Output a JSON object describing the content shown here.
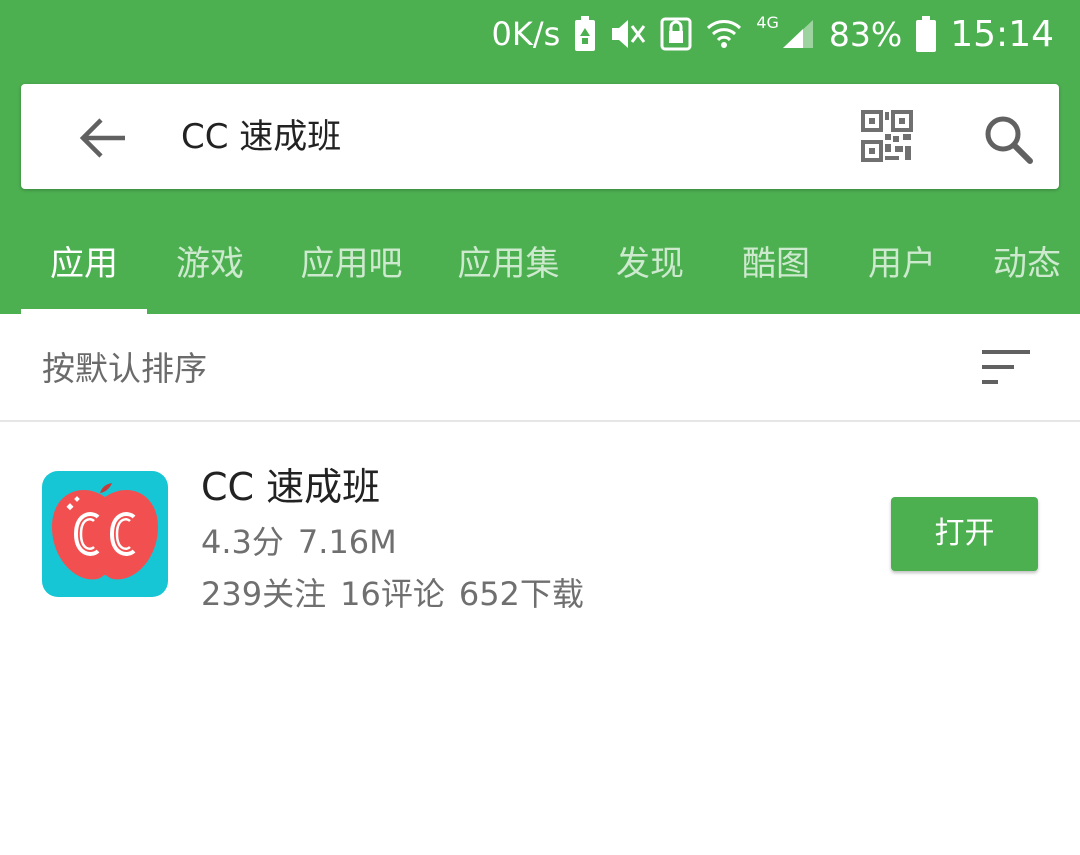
{
  "colors": {
    "primary_green": "#4caf50",
    "app_icon_bg": "#16c6d5",
    "app_icon_fg": "#f25050"
  },
  "status_bar": {
    "net_speed": "0K/s",
    "network_type": "4G",
    "battery_percent": "83%",
    "time": "15:14",
    "icons": [
      "battery-saver-icon",
      "vibrate-mute-icon",
      "nfc-lock-icon",
      "wifi-icon",
      "signal-icon",
      "battery-icon"
    ]
  },
  "search": {
    "query": "CC 速成班",
    "icons": [
      "back-arrow-icon",
      "qr-code-icon",
      "search-icon"
    ]
  },
  "tabs": [
    {
      "label": "应用",
      "active": true
    },
    {
      "label": "游戏"
    },
    {
      "label": "应用吧"
    },
    {
      "label": "应用集"
    },
    {
      "label": "发现"
    },
    {
      "label": "酷图"
    },
    {
      "label": "用户"
    },
    {
      "label": "动态"
    }
  ],
  "sort": {
    "label": "按默认排序",
    "icon": "sort-icon"
  },
  "results": [
    {
      "name": "CC 速成班",
      "rating": "4.3分",
      "size": "7.16M",
      "follows": "239关注",
      "comments": "16评论",
      "downloads": "652下载",
      "button_label": "打开",
      "icon": "cc-app-icon"
    }
  ]
}
